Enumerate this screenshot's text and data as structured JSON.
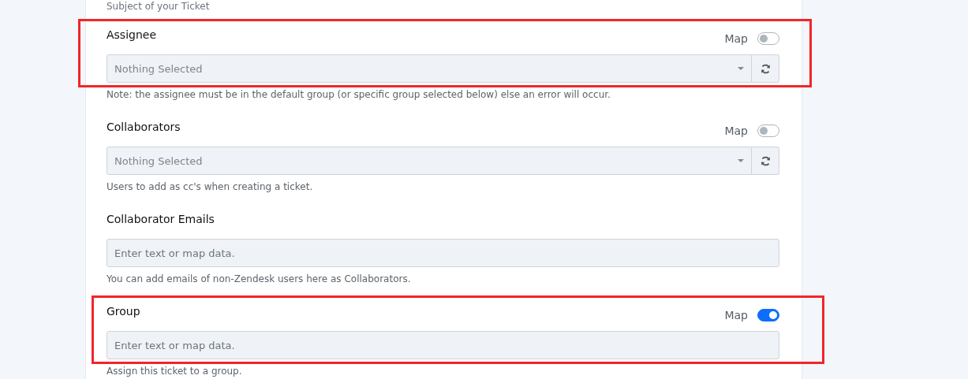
{
  "top_help": "Subject of your Ticket",
  "fields": [
    {
      "label": "Assignee",
      "kind": "select",
      "map_toggle": {
        "label": "Map",
        "on": false
      },
      "placeholder": "Nothing Selected",
      "help": "Note: the assignee must be in the default group (or specific group selected below) else an error will occur.",
      "highlighted": true
    },
    {
      "label": "Collaborators",
      "kind": "select",
      "map_toggle": {
        "label": "Map",
        "on": false
      },
      "placeholder": "Nothing Selected",
      "help": "Users to add as cc's when creating a ticket.",
      "highlighted": false
    },
    {
      "label": "Collaborator Emails",
      "kind": "text",
      "placeholder": "Enter text or map data.",
      "help": "You can add emails of non-Zendesk users here as Collaborators.",
      "highlighted": false
    },
    {
      "label": "Group",
      "kind": "text",
      "map_toggle": {
        "label": "Map",
        "on": true
      },
      "placeholder": "Enter text or map data.",
      "help": "Assign this ticket to a group.",
      "highlighted": true
    }
  ]
}
